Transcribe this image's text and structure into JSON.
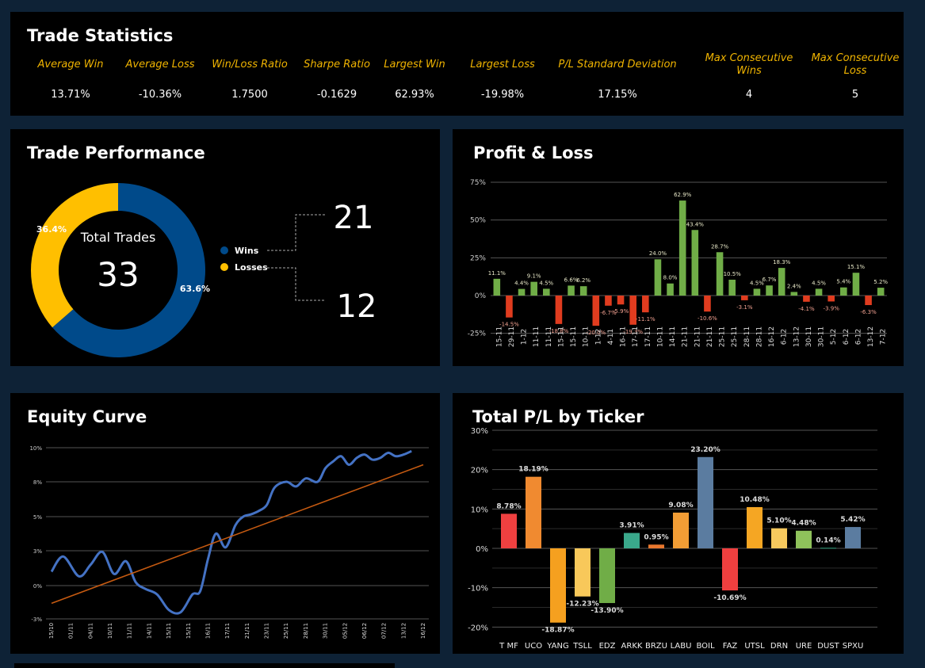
{
  "stats": {
    "title": "Trade Statistics",
    "items": [
      {
        "label": "Average Win",
        "value": "13.71%"
      },
      {
        "label": "Average Loss",
        "value": "-10.36%"
      },
      {
        "label": "Win/Loss Ratio",
        "value": "1.7500"
      },
      {
        "label": "Sharpe Ratio",
        "value": "-0.1629"
      },
      {
        "label": "Largest Win",
        "value": "62.93%"
      },
      {
        "label": "Largest Loss",
        "value": "-19.98%"
      },
      {
        "label": "P/L Standard Deviation",
        "value": "17.15%"
      },
      {
        "label": "Max Consecutive Wins",
        "value": "4"
      },
      {
        "label": "Max Consecutive Loss",
        "value": "5"
      }
    ]
  },
  "performance": {
    "title": "Trade Performance",
    "center_label": "Total Trades",
    "total": "33",
    "wins_count": "21",
    "losses_count": "12",
    "wins_label": "Wins",
    "losses_label": "Losses",
    "wins_color": "#004a8a",
    "losses_color": "#ffbf00"
  },
  "chart_data": [
    {
      "type": "pie",
      "categories": [
        "Wins",
        "Losses"
      ],
      "values": [
        63.6,
        36.4
      ],
      "data_labels": [
        "63.6%",
        "36.4%"
      ],
      "center_text": [
        "Total Trades",
        "33"
      ],
      "colors": [
        "#004a8a",
        "#ffbf00"
      ],
      "legend": "right"
    },
    {
      "type": "bar",
      "title": "Profit & Loss",
      "categories": [
        "15-11",
        "29-11",
        "1-12",
        "11-11",
        "11-11",
        "15-11",
        "15-11",
        "10-11",
        "1-12",
        "4-11",
        "16-11",
        "17-11",
        "17-11",
        "10-11",
        "14-11",
        "21-11",
        "21-11",
        "21-11",
        "25-11",
        "25-11",
        "28-11",
        "28-11",
        "16-12",
        "6-12",
        "13-12",
        "30-11",
        "30-11",
        "5-12",
        "6-12",
        "6-12",
        "13-12",
        "7-12"
      ],
      "values": [
        11.1,
        -14.5,
        4.4,
        9.1,
        4.5,
        -18.8,
        6.6,
        6.2,
        -20.0,
        -6.7,
        -5.9,
        -19.3,
        -11.1,
        24.0,
        8.0,
        62.9,
        43.4,
        -10.6,
        28.7,
        10.5,
        -3.1,
        4.5,
        6.7,
        18.3,
        2.4,
        -4.1,
        4.5,
        -3.9,
        5.4,
        15.1,
        -6.3,
        5.2
      ],
      "data_labels": [
        "11.1%",
        "-14.5%",
        "4.4%",
        "9.1%",
        "4.5%",
        "-18.8%",
        "6.6%",
        "6.2%",
        "-20.0%",
        "-6.7%",
        "-5.9%",
        "-19.3%",
        "-11.1%",
        "24.0%",
        "8.0%",
        "62.9%",
        "43.4%",
        "-10.6%",
        "28.7%",
        "10.5%",
        "-3.1%",
        "4.5%",
        "6.7%",
        "18.3%",
        "2.4%",
        "-4.1%",
        "4.5%",
        "-3.9%",
        "5.4%",
        "15.1%",
        "-6.3%",
        "5.2%"
      ],
      "yticks": [
        "-25%",
        "0%",
        "25%",
        "50%",
        "75%"
      ],
      "ylim": [
        -25,
        75
      ],
      "positive_color": "#70ad47",
      "negative_color": "#e03c1f",
      "grid": true
    },
    {
      "type": "line",
      "title": "Equity Curve",
      "x": [
        "15/10",
        "01/11",
        "04/11",
        "10/11",
        "11/11",
        "14/11",
        "15/11",
        "15/11",
        "16/11",
        "17/11",
        "21/11",
        "23/11",
        "25/11",
        "28/11",
        "30/11",
        "05/12",
        "06/12",
        "07/12",
        "13/12",
        "16/12"
      ],
      "x_positions": [
        0,
        1,
        2,
        3,
        4,
        5,
        6,
        7,
        8,
        9,
        10,
        11,
        12,
        13,
        14,
        15,
        16,
        17,
        18,
        19
      ],
      "series": [
        {
          "values_x": [
            0,
            0.6,
            1.4,
            2.0,
            2.6,
            3.2,
            3.8,
            4.3,
            4.8,
            5.4,
            6.0,
            6.6,
            7.2,
            7.6,
            8.0,
            8.4,
            8.9,
            9.4,
            9.8,
            10.2,
            10.6,
            11.0,
            11.4,
            12.0,
            12.5,
            13.0,
            13.6,
            14.0,
            14.4,
            14.8,
            15.2,
            15.6,
            16.0,
            16.4,
            16.8,
            17.2,
            17.6,
            18.0,
            18.4
          ],
          "values": [
            1.2,
            2.5,
            0.8,
            1.8,
            2.9,
            1.0,
            2.1,
            0.3,
            -0.3,
            -0.8,
            -2.2,
            -2.4,
            -0.8,
            -0.5,
            2.3,
            4.0,
            3.2,
            4.5,
            5.0,
            5.2,
            5.5,
            6.0,
            7.5,
            8.0,
            7.6,
            8.2,
            8.0,
            8.8,
            9.2,
            9.5,
            9.0,
            9.4,
            9.6,
            9.3,
            9.4,
            9.7,
            9.5,
            9.6,
            9.8
          ],
          "color": "#4472c4"
        },
        {
          "values_x": [
            0,
            19
          ],
          "values": [
            -1.6,
            9.0
          ],
          "color": "#c55a11"
        }
      ],
      "yticks": [
        "-3%",
        "0%",
        "3%",
        "5%",
        "8%",
        "10%"
      ],
      "ylim": [
        -3,
        10
      ],
      "grid": true
    },
    {
      "type": "bar",
      "title": "Total P/L by Ticker",
      "categories": [
        "T MF",
        "UCO",
        "YANG",
        "TSLL",
        "EDZ",
        "ARKK",
        "BRZU",
        "LABU",
        "BOIL",
        "FAZ",
        "UTSL",
        "DRN",
        "URE",
        "DUST",
        "SPXU"
      ],
      "values": [
        8.78,
        18.19,
        -18.87,
        -12.23,
        -13.9,
        3.91,
        0.95,
        9.08,
        23.2,
        -10.69,
        10.48,
        5.1,
        4.48,
        0.14,
        5.42
      ],
      "data_labels": [
        "8.78%",
        "18.19%",
        "-18.87%",
        "-12.23%",
        "-13.90%",
        "3.91%",
        "0.95%",
        "9.08%",
        "23.20%",
        "-10.69%",
        "10.48%",
        "5.10%",
        "4.48%",
        "0.14%",
        "5.42%"
      ],
      "colors": [
        "#ef4040",
        "#f08a30",
        "#f5a01f",
        "#f8c85a",
        "#70ad47",
        "#3aa88b",
        "#e8772e",
        "#f29d35",
        "#5b7ca0",
        "#ef3f3f",
        "#f5a623",
        "#f7c95e",
        "#8fc25b",
        "#2e9e7a",
        "#5b7ca0"
      ],
      "yticks": [
        "-20%",
        "-10%",
        "0%",
        "10%",
        "20%",
        "30%"
      ],
      "ylim": [
        -20,
        30
      ],
      "grid": true
    }
  ]
}
